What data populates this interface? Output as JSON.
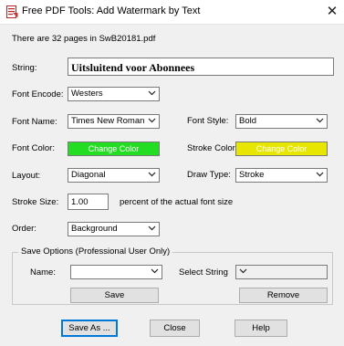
{
  "window": {
    "title": "Free PDF Tools: Add Watermark by Text",
    "close_glyph": "✕"
  },
  "info": {
    "pages_text": "There are 32 pages in SwB20181.pdf"
  },
  "string": {
    "label": "String:",
    "value": "Uitsluitend voor Abonnees"
  },
  "font_encode": {
    "label": "Font Encode:",
    "value": "Westers"
  },
  "font_name": {
    "label": "Font Name:",
    "value": "Times New Roman"
  },
  "font_style": {
    "label": "Font Style:",
    "value": "Bold"
  },
  "font_color": {
    "label": "Font Color:",
    "button_label": "Change Color",
    "color": "#22dd22"
  },
  "stroke_color": {
    "label": "Stroke Color:",
    "button_label": "Change Color",
    "color": "#e6e600"
  },
  "layout": {
    "label": "Layout:",
    "value": "Diagonal"
  },
  "draw_type": {
    "label": "Draw Type:",
    "value": "Stroke"
  },
  "stroke_size": {
    "label": "Stroke Size:",
    "value": "1.00",
    "suffix": "percent of the actual font size"
  },
  "order": {
    "label": "Order:",
    "value": "Background"
  },
  "save_options": {
    "legend": "Save Options (Professional User Only)",
    "name_label": "Name:",
    "name_value": "",
    "select_string_label": "Select String",
    "select_string_value": "",
    "save_button": "Save",
    "remove_button": "Remove"
  },
  "footer": {
    "save_as_button": "Save As ...",
    "close_button": "Close",
    "help_button": "Help"
  },
  "icons": {
    "app": "pdf-app-icon",
    "close": "close-icon",
    "dropdown": "chevron-down-icon"
  }
}
